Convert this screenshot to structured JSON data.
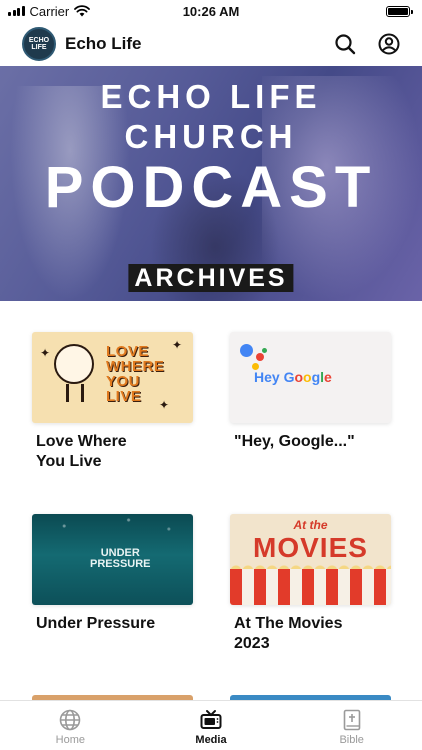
{
  "status_bar": {
    "carrier": "Carrier",
    "time": "10:26 AM"
  },
  "header": {
    "logo_text": [
      "ECHO",
      "LIFE"
    ],
    "title": "Echo Life",
    "search_icon": "search-icon",
    "profile_icon": "profile-icon"
  },
  "hero": {
    "line1": "ECHO LIFE",
    "line2": "CHURCH",
    "line3": "PODCAST",
    "tag": "ARCHIVES"
  },
  "series": [
    {
      "title": "Love Where You Live",
      "thumb_text": [
        "LOVE",
        "WHERE",
        "YOU",
        "LIVE"
      ]
    },
    {
      "title": "\"Hey, Google...\"",
      "thumb_text": "Hey Google"
    },
    {
      "title": "Under Pressure",
      "thumb_text": [
        "UNDER",
        "PRESSURE"
      ]
    },
    {
      "title": "At The Movies 2023",
      "thumb_text": [
        "At the",
        "MOVIES"
      ]
    }
  ],
  "tabs": [
    {
      "label": "Home",
      "icon": "globe-icon",
      "active": false
    },
    {
      "label": "Media",
      "icon": "tv-icon",
      "active": true
    },
    {
      "label": "Bible",
      "icon": "bible-icon",
      "active": false
    }
  ],
  "colors": {
    "hero_overlay": "#565b98",
    "love_bg": "#f6e0b0",
    "love_text": "#e07a1f",
    "pressure_bg": "#146a72",
    "movies_red": "#d53a2a",
    "google_blue": "#4285F4",
    "google_red": "#EA4335",
    "google_yellow": "#FBBC05",
    "google_green": "#34A853"
  }
}
